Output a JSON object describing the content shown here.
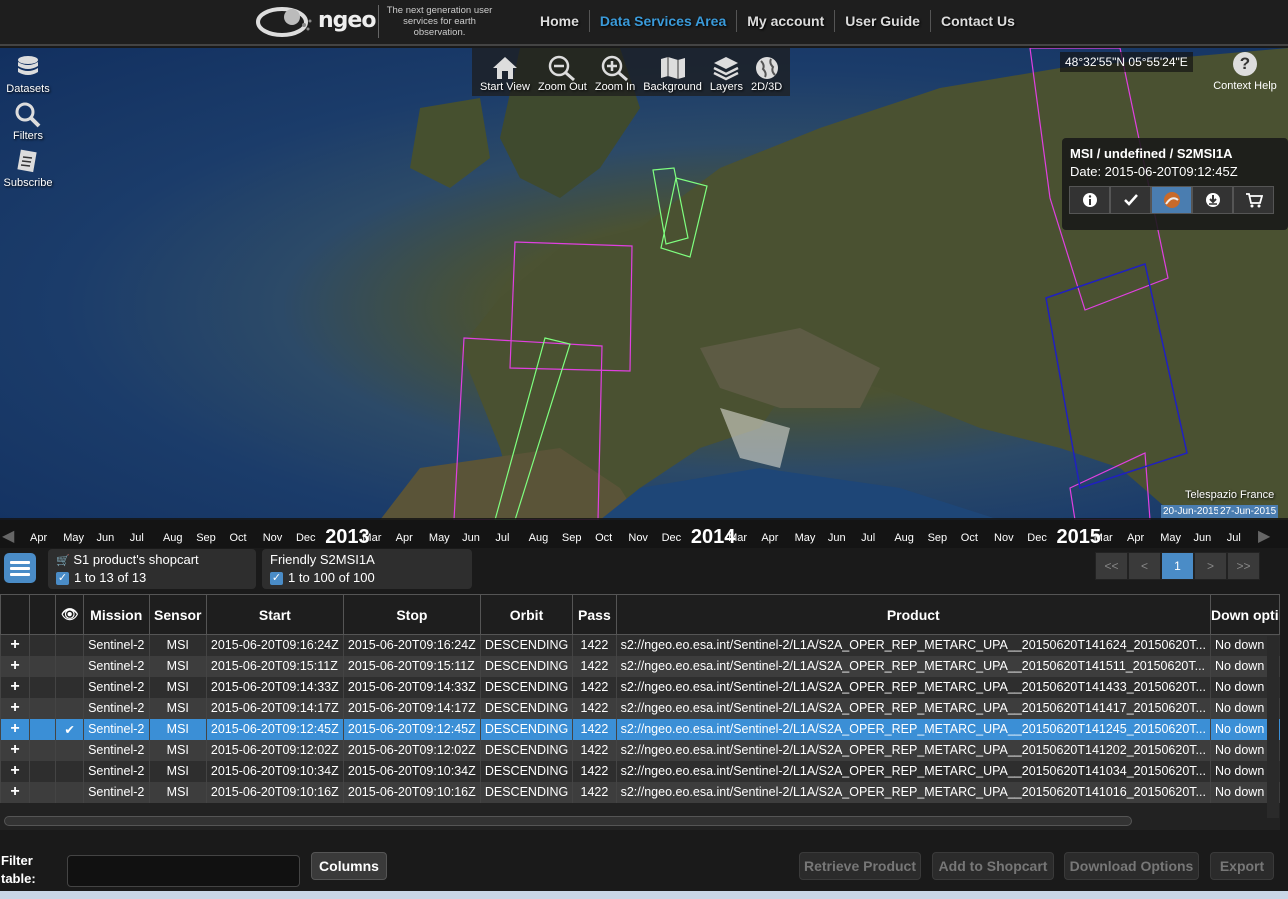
{
  "header": {
    "logo_text": "ngeo",
    "tagline": "The next generation user services for earth observation.",
    "nav": [
      {
        "label": "Home",
        "active": false
      },
      {
        "label": "Data Services Area",
        "active": true
      },
      {
        "label": "My account",
        "active": false
      },
      {
        "label": "User Guide",
        "active": false
      },
      {
        "label": "Contact Us",
        "active": false
      }
    ]
  },
  "left_tools": [
    {
      "label": "Datasets",
      "icon": "database-icon"
    },
    {
      "label": "Filters",
      "icon": "search-icon"
    },
    {
      "label": "Subscribe",
      "icon": "subscribe-icon"
    }
  ],
  "map_tools": [
    {
      "label": "Start View",
      "icon": "home-icon"
    },
    {
      "label": "Zoom Out",
      "icon": "zoom-out-icon"
    },
    {
      "label": "Zoom In",
      "icon": "zoom-in-icon"
    },
    {
      "label": "Background",
      "icon": "map-icon"
    },
    {
      "label": "Layers",
      "icon": "layers-icon"
    },
    {
      "label": "2D/3D",
      "icon": "globe-icon"
    }
  ],
  "coordinates": "48°32'55\"N 05°55'24\"E",
  "context_help": "Context Help",
  "popup": {
    "title": "MSI / undefined / S2MSI1A",
    "date": "Date: 2015-06-20T09:12:45Z"
  },
  "attribution": "Telespazio France",
  "timeline": {
    "labels": [
      "Apr",
      "May",
      "Jun",
      "Jul",
      "Aug",
      "Sep",
      "Oct",
      "Nov",
      "Dec",
      "2013",
      "Mar",
      "Apr",
      "May",
      "Jun",
      "Jul",
      "Aug",
      "Sep",
      "Oct",
      "Nov",
      "Dec",
      "2014",
      "Mar",
      "Apr",
      "May",
      "Jun",
      "Jul",
      "Aug",
      "Sep",
      "Oct",
      "Nov",
      "Dec",
      "2015",
      "Mar",
      "Apr",
      "May",
      "Jun",
      "Jul"
    ],
    "selection_start": "20-Jun-2015",
    "selection_end": "27-Jun-2015"
  },
  "datasets": [
    {
      "name": "S1 product's shopcart",
      "count": "1 to 13 of 13"
    },
    {
      "name": "Friendly S2MSI1A",
      "count": "1 to 100 of 100"
    }
  ],
  "pager": [
    "<<",
    "<",
    "1",
    ">",
    ">>"
  ],
  "table": {
    "columns": [
      "",
      "",
      "",
      "Mission",
      "Sensor",
      "Start",
      "Stop",
      "Orbit",
      "Pass",
      "Product",
      "Down opti"
    ],
    "rows": [
      {
        "mission": "Sentinel-2",
        "sensor": "MSI",
        "start": "2015-06-20T09:16:24Z",
        "stop": "2015-06-20T09:16:24Z",
        "orbit": "DESCENDING",
        "pass": "1422",
        "product": "s2://ngeo.eo.esa.int/Sentinel-2/L1A/S2A_OPER_REP_METARC_UPA__20150620T141624_20150620T...",
        "download": "No down",
        "selected": false
      },
      {
        "mission": "Sentinel-2",
        "sensor": "MSI",
        "start": "2015-06-20T09:15:11Z",
        "stop": "2015-06-20T09:15:11Z",
        "orbit": "DESCENDING",
        "pass": "1422",
        "product": "s2://ngeo.eo.esa.int/Sentinel-2/L1A/S2A_OPER_REP_METARC_UPA__20150620T141511_20150620T...",
        "download": "No down",
        "selected": false
      },
      {
        "mission": "Sentinel-2",
        "sensor": "MSI",
        "start": "2015-06-20T09:14:33Z",
        "stop": "2015-06-20T09:14:33Z",
        "orbit": "DESCENDING",
        "pass": "1422",
        "product": "s2://ngeo.eo.esa.int/Sentinel-2/L1A/S2A_OPER_REP_METARC_UPA__20150620T141433_20150620T...",
        "download": "No down",
        "selected": false
      },
      {
        "mission": "Sentinel-2",
        "sensor": "MSI",
        "start": "2015-06-20T09:14:17Z",
        "stop": "2015-06-20T09:14:17Z",
        "orbit": "DESCENDING",
        "pass": "1422",
        "product": "s2://ngeo.eo.esa.int/Sentinel-2/L1A/S2A_OPER_REP_METARC_UPA__20150620T141417_20150620T...",
        "download": "No down",
        "selected": false
      },
      {
        "mission": "Sentinel-2",
        "sensor": "MSI",
        "start": "2015-06-20T09:12:45Z",
        "stop": "2015-06-20T09:12:45Z",
        "orbit": "DESCENDING",
        "pass": "1422",
        "product": "s2://ngeo.eo.esa.int/Sentinel-2/L1A/S2A_OPER_REP_METARC_UPA__20150620T141245_20150620T...",
        "download": "No down",
        "selected": true
      },
      {
        "mission": "Sentinel-2",
        "sensor": "MSI",
        "start": "2015-06-20T09:12:02Z",
        "stop": "2015-06-20T09:12:02Z",
        "orbit": "DESCENDING",
        "pass": "1422",
        "product": "s2://ngeo.eo.esa.int/Sentinel-2/L1A/S2A_OPER_REP_METARC_UPA__20150620T141202_20150620T...",
        "download": "No down",
        "selected": false
      },
      {
        "mission": "Sentinel-2",
        "sensor": "MSI",
        "start": "2015-06-20T09:10:34Z",
        "stop": "2015-06-20T09:10:34Z",
        "orbit": "DESCENDING",
        "pass": "1422",
        "product": "s2://ngeo.eo.esa.int/Sentinel-2/L1A/S2A_OPER_REP_METARC_UPA__20150620T141034_20150620T...",
        "download": "No down",
        "selected": false
      },
      {
        "mission": "Sentinel-2",
        "sensor": "MSI",
        "start": "2015-06-20T09:10:16Z",
        "stop": "2015-06-20T09:10:16Z",
        "orbit": "DESCENDING",
        "pass": "1422",
        "product": "s2://ngeo.eo.esa.int/Sentinel-2/L1A/S2A_OPER_REP_METARC_UPA__20150620T141016_20150620T...",
        "download": "No down",
        "selected": false
      }
    ]
  },
  "bottom": {
    "filter_label": "Filter table:",
    "columns_button": "Columns",
    "actions": [
      "Retrieve Product",
      "Add to Shopcart",
      "Download Options",
      "Export"
    ]
  },
  "colors": {
    "accent": "#3a9ad9",
    "selected_row": "#3b8fd6",
    "footprint_magenta": "#e040e0",
    "footprint_green": "#7fff7f",
    "footprint_blue": "#2020c0"
  }
}
